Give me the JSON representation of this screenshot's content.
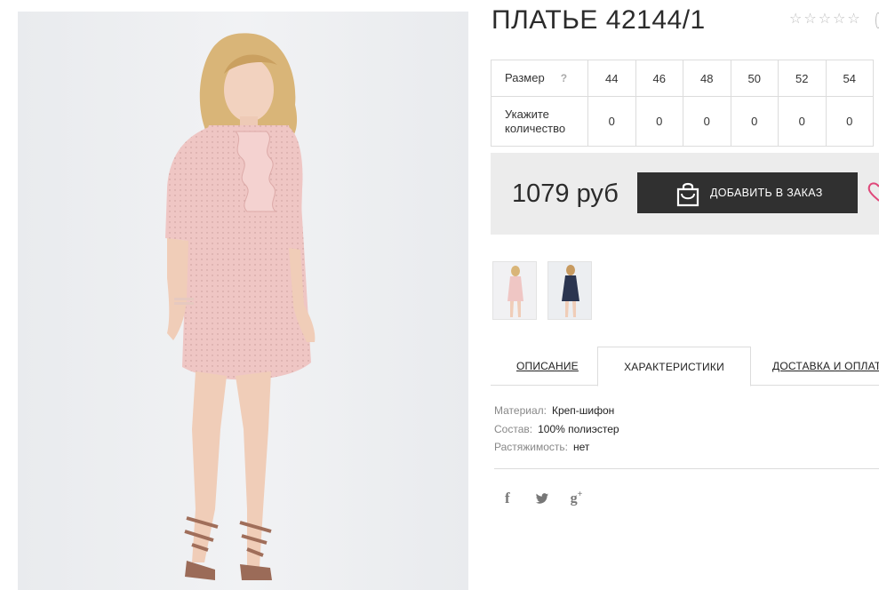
{
  "product": {
    "title": "ПЛАТЬЕ 42144/1",
    "rating_stars": 5,
    "price": "1079 руб",
    "add_button_label": "ДОБАВИТЬ В ЗАКАЗ"
  },
  "size_table": {
    "size_label": "Размер",
    "help_mark": "?",
    "sizes": [
      "44",
      "46",
      "48",
      "50",
      "52",
      "54"
    ],
    "qty_label_line1": "Укажите",
    "qty_label_line2": "количество",
    "quantities": [
      "0",
      "0",
      "0",
      "0",
      "0",
      "0"
    ]
  },
  "tabs": {
    "description": "ОПИСАНИЕ",
    "characteristics": "ХАРАКТЕРИСТИКИ",
    "delivery": "ДОСТАВКА И ОПЛАТА"
  },
  "characteristics": [
    {
      "key": "Материал:",
      "value": "Креп-шифон"
    },
    {
      "key": "Состав:",
      "value": "100% полиэстер"
    },
    {
      "key": "Растяжимость:",
      "value": "нет"
    }
  ],
  "social": {
    "facebook": "f",
    "twitter": "🐦",
    "gplus": "g"
  },
  "colors": {
    "button_bg": "#303030",
    "order_box_bg": "#ececec",
    "dress_pink": "#eec3c3",
    "dress_navy": "#2b3550",
    "heart": "#e0487a"
  }
}
